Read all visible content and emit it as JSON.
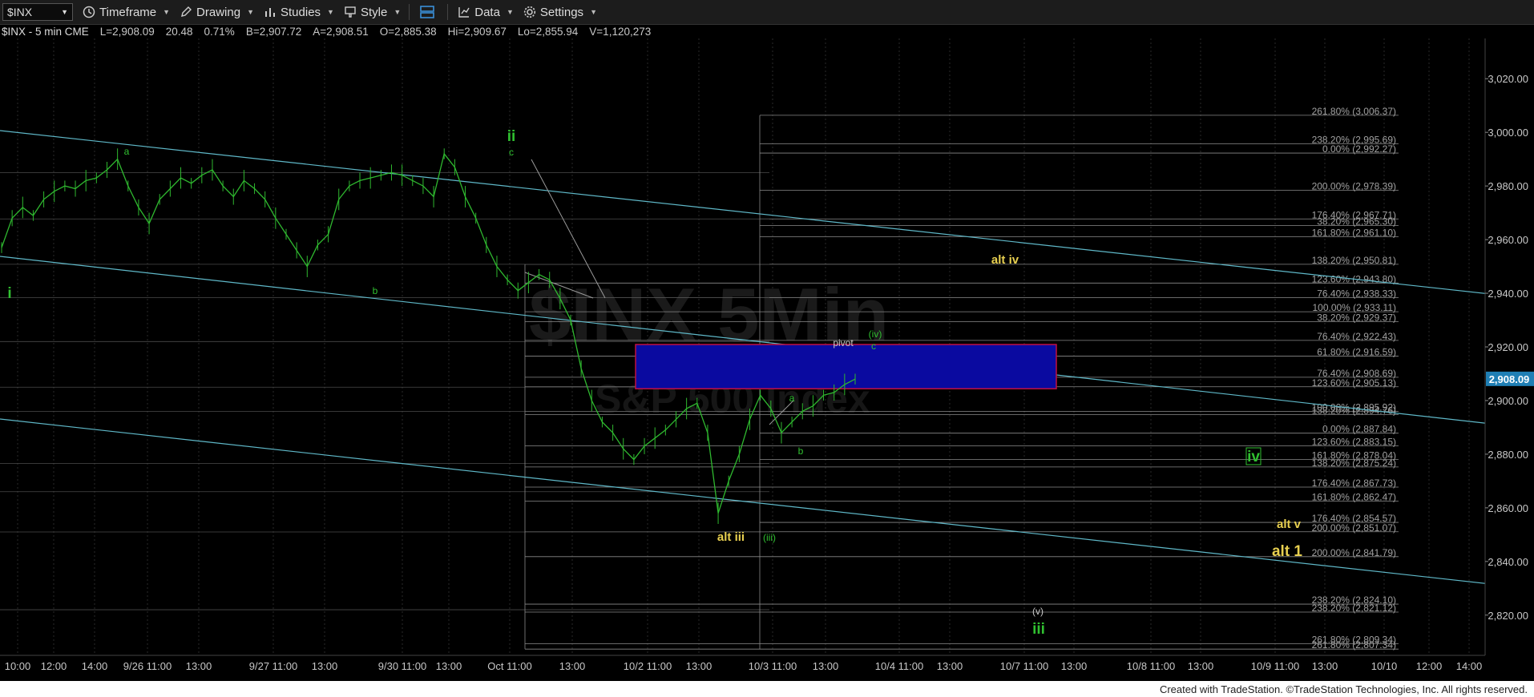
{
  "toolbar": {
    "symbol": "$INX",
    "timeframe": "Timeframe",
    "drawing": "Drawing",
    "studies": "Studies",
    "style": "Style",
    "data": "Data",
    "settings": "Settings"
  },
  "infobar": {
    "symbol_info": "$INX - 5 min  CME",
    "last": "L=2,908.09",
    "change": "20.48",
    "pct": "0.71%",
    "bid": "B=2,907.72",
    "ask": "A=2,908.51",
    "open": "O=2,885.38",
    "high": "Hi=2,909.67",
    "low": "Lo=2,855.94",
    "volume": "V=1,120,273"
  },
  "watermark": {
    "line1": "$INX 5Min",
    "line2": "S&P 500 Index"
  },
  "footer": "Created with TradeStation. ©TradeStation Technologies, Inc. All rights reserved.",
  "colors": {
    "wave_green": "#30c030",
    "alt_yellow": "#e8d050",
    "channel": "#5fb8c8",
    "box_fill": "#0a0aa0",
    "box_border": "#c01040",
    "price_tag": "#1f7fb5"
  },
  "chart_data": {
    "type": "line",
    "title": "$INX - 5 min",
    "ylim": [
      2805,
      3035
    ],
    "y_ticks": [
      3020,
      3000,
      2980,
      2960,
      2940,
      2920,
      2900,
      2880,
      2860,
      2840,
      2820
    ],
    "y_tick_labels": [
      "3,020.00",
      "3,000.00",
      "2,980.00",
      "2,960.00",
      "2,940.00",
      "2,920.00",
      "2,900.00",
      "2,880.00",
      "2,860.00",
      "2,840.00",
      "2,820.00"
    ],
    "x_tick_labels": [
      "10:00",
      "12:00",
      "14:00",
      "9/26 11:00",
      "13:00",
      "9/27 11:00",
      "13:00",
      "9/30 11:00",
      "13:00",
      "Oct  11:00",
      "13:00",
      "10/2 11:00",
      "13:00",
      "10/3 11:00",
      "13:00",
      "10/4 11:00",
      "13:00",
      "10/7 11:00",
      "13:00",
      "10/8 11:00",
      "13:00",
      "10/9 11:00",
      "13:00",
      "10/10",
      "12:00",
      "14:00"
    ],
    "last_price": 2908.09,
    "last_price_label": "2,908.09",
    "series": [
      {
        "values": [
          2957,
          2968,
          2972,
          2969,
          2975,
          2978,
          2980,
          2979,
          2982,
          2983,
          2986,
          2990,
          2980,
          2972,
          2966,
          2975,
          2979,
          2983,
          2981,
          2984,
          2986,
          2980,
          2976,
          2982,
          2979,
          2975,
          2968,
          2962,
          2956,
          2950,
          2958,
          2962,
          2975,
          2980,
          2982,
          2983,
          2984,
          2985,
          2984,
          2982,
          2980,
          2976,
          2992,
          2987,
          2976,
          2968,
          2958,
          2950,
          2945,
          2941,
          2944,
          2947,
          2945,
          2938,
          2930,
          2912,
          2900,
          2892,
          2888,
          2882,
          2878,
          2883,
          2886,
          2889,
          2893,
          2897,
          2899,
          2888,
          2858,
          2870,
          2880,
          2893,
          2902,
          2897,
          2888,
          2892,
          2896,
          2898,
          2902,
          2903,
          2906,
          2908
        ]
      }
    ],
    "fib_levels": [
      {
        "label": "261.80% (3,006.37)",
        "y": 3006.37
      },
      {
        "label": "238.20% (2,995.69)",
        "y": 2995.69
      },
      {
        "label": "0.00% (2,992.27)",
        "y": 2992.27
      },
      {
        "label": "200.00% (2,978.39)",
        "y": 2978.39
      },
      {
        "label": "176.40% (2,967.71)",
        "y": 2967.71
      },
      {
        "label": "38.20% (2,965.30)",
        "y": 2965.3
      },
      {
        "label": "161.80% (2,961.10)",
        "y": 2961.1
      },
      {
        "label": "138.20% (2,950.81)",
        "y": 2950.81
      },
      {
        "label": "123.60% (2,943.80)",
        "y": 2943.8
      },
      {
        "label": "76.40% (2,938.33)",
        "y": 2938.33
      },
      {
        "label": "100.00% (2,933.11)",
        "y": 2933.11
      },
      {
        "label": "38.20% (2,929.37)",
        "y": 2929.37
      },
      {
        "label": "76.40% (2,922.43)",
        "y": 2922.43
      },
      {
        "label": "61.80% (2,916.59)",
        "y": 2916.59
      },
      {
        "label": "76.40% (2,908.69)",
        "y": 2908.69
      },
      {
        "label": "123.60% (2,905.13)",
        "y": 2905.13
      },
      {
        "label": "100.00% (2,895.92)",
        "y": 2895.92
      },
      {
        "label": "138.20% (2,894.76)",
        "y": 2894.76
      },
      {
        "label": "0.00% (2,887.84)",
        "y": 2887.84
      },
      {
        "label": "123.60% (2,883.15)",
        "y": 2883.15
      },
      {
        "label": "161.80% (2,878.04)",
        "y": 2878.04
      },
      {
        "label": "138.20% (2,875.24)",
        "y": 2875.24
      },
      {
        "label": "176.40% (2,867.73)",
        "y": 2867.73
      },
      {
        "label": "161.80% (2,862.47)",
        "y": 2862.47
      },
      {
        "label": "176.40% (2,854.57)",
        "y": 2854.57
      },
      {
        "label": "200.00% (2,851.07)",
        "y": 2851.07
      },
      {
        "label": "200.00% (2,841.79)",
        "y": 2841.79
      },
      {
        "label": "238.20% (2,824.10)",
        "y": 2824.1
      },
      {
        "label": "238.20% (2,821.12)",
        "y": 2821.12
      },
      {
        "label": "261.80% (2,809.34)",
        "y": 2809.34
      },
      {
        "label": "261.80% (2,807.34)",
        "y": 2807.34
      }
    ],
    "annotations": [
      {
        "text": "i",
        "color": "green",
        "size": "large"
      },
      {
        "text": "a",
        "color": "green",
        "size": "small"
      },
      {
        "text": "b",
        "color": "green",
        "size": "small"
      },
      {
        "text": "ii",
        "color": "green",
        "size": "large"
      },
      {
        "text": "c",
        "color": "green",
        "size": "small"
      },
      {
        "text": "alt iii",
        "color": "yellow",
        "size": "medium"
      },
      {
        "text": "(iii)",
        "color": "green",
        "size": "small"
      },
      {
        "text": "a",
        "color": "green",
        "size": "small"
      },
      {
        "text": "b",
        "color": "green",
        "size": "small"
      },
      {
        "text": "pivot",
        "color": "white",
        "size": "small"
      },
      {
        "text": "(iv)",
        "color": "green",
        "size": "small"
      },
      {
        "text": "c",
        "color": "green",
        "size": "small"
      },
      {
        "text": "alt iv",
        "color": "yellow",
        "size": "medium"
      },
      {
        "text": "(v)",
        "color": "white",
        "size": "small"
      },
      {
        "text": "iii",
        "color": "green",
        "size": "large"
      },
      {
        "text": "iv",
        "color": "green",
        "size": "large"
      },
      {
        "text": "alt v",
        "color": "yellow",
        "size": "medium"
      },
      {
        "text": "alt 1",
        "color": "yellow",
        "size": "large"
      }
    ]
  }
}
